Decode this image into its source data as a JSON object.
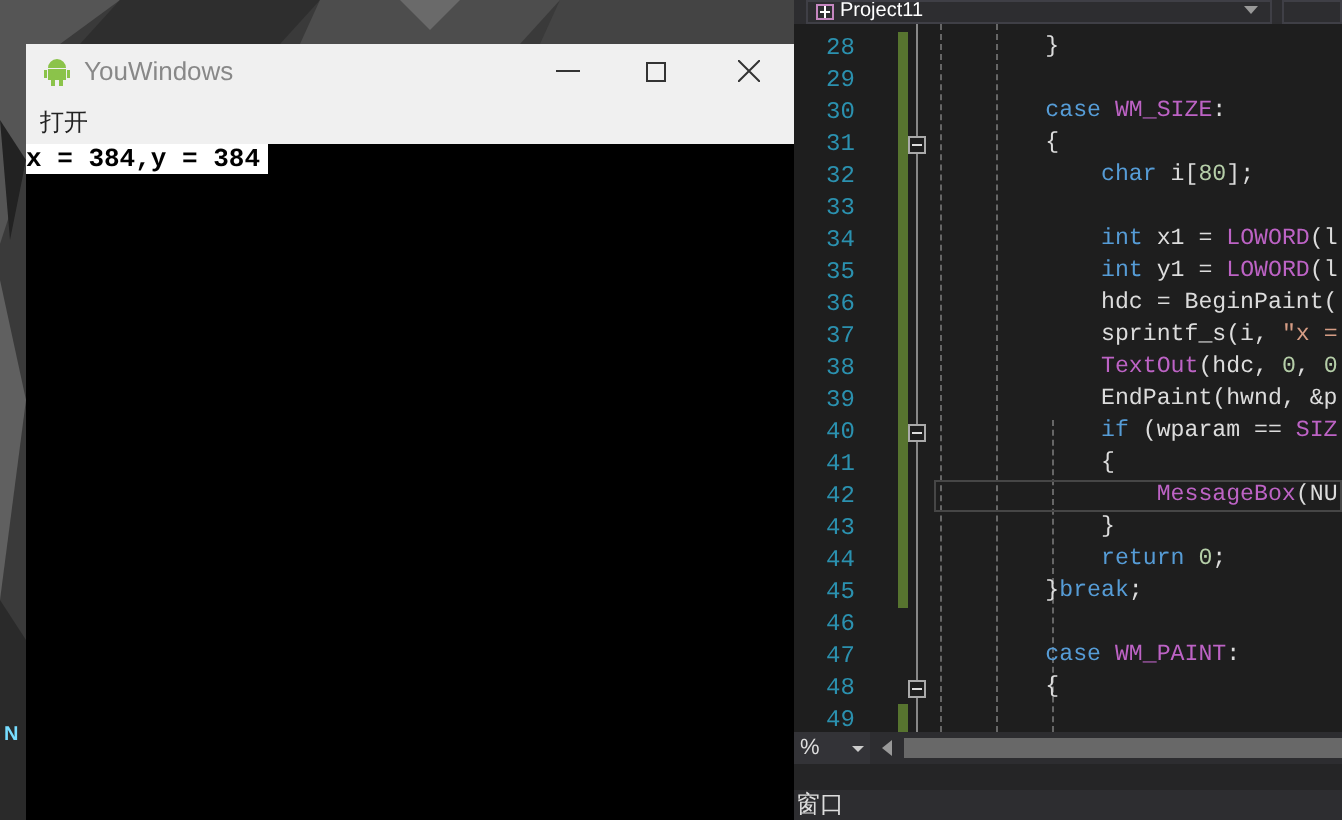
{
  "desktop_icon_label": "N",
  "app_window": {
    "title": "YouWindows",
    "menu": [
      "打开"
    ],
    "client_text": "x = 384,y = 384"
  },
  "editor": {
    "project": "Project11",
    "lines": [
      {
        "number": "28",
        "changed": true,
        "fold": false,
        "current": false,
        "tokens": [
          {
            "kind": "plain",
            "text": "        }"
          }
        ]
      },
      {
        "number": "29",
        "changed": true,
        "fold": false,
        "current": false
      },
      {
        "number": "30",
        "changed": true,
        "fold": false,
        "current": false,
        "tokens": [
          {
            "kind": "keyword",
            "text": "        case"
          },
          {
            "kind": "macro",
            "text": " WM_SIZE"
          },
          {
            "kind": "plain",
            "text": ":"
          }
        ]
      },
      {
        "number": "31",
        "changed": true,
        "fold": true,
        "current": false,
        "tokens": [
          {
            "kind": "plain",
            "text": "        {"
          }
        ]
      },
      {
        "number": "32",
        "changed": true,
        "fold": false,
        "current": false,
        "tokens": [
          {
            "kind": "keyword",
            "text": "            char"
          },
          {
            "kind": "plain",
            "text": " i["
          },
          {
            "kind": "number",
            "text": "80"
          },
          {
            "kind": "plain",
            "text": "];"
          }
        ]
      },
      {
        "number": "33",
        "changed": true,
        "fold": false,
        "current": false
      },
      {
        "number": "34",
        "changed": true,
        "fold": false,
        "current": false,
        "tokens": [
          {
            "kind": "keyword",
            "text": "            int"
          },
          {
            "kind": "plain",
            "text": " x1 ="
          },
          {
            "kind": "macro",
            "text": " LOWORD"
          },
          {
            "kind": "plain",
            "text": "(l"
          }
        ]
      },
      {
        "number": "35",
        "changed": true,
        "fold": false,
        "current": false,
        "tokens": [
          {
            "kind": "keyword",
            "text": "            int"
          },
          {
            "kind": "plain",
            "text": " y1 ="
          },
          {
            "kind": "macro",
            "text": " LOWORD"
          },
          {
            "kind": "plain",
            "text": "(l"
          }
        ]
      },
      {
        "number": "36",
        "changed": true,
        "fold": false,
        "current": false,
        "tokens": [
          {
            "kind": "plain",
            "text": "            hdc = BeginPaint("
          }
        ]
      },
      {
        "number": "37",
        "changed": true,
        "fold": false,
        "current": false,
        "tokens": [
          {
            "kind": "plain",
            "text": "            sprintf_s(i,"
          },
          {
            "kind": "string",
            "text": " \"x ="
          }
        ]
      },
      {
        "number": "38",
        "changed": true,
        "fold": false,
        "current": false,
        "tokens": [
          {
            "kind": "macro",
            "text": "            TextOut"
          },
          {
            "kind": "plain",
            "text": "(hdc,"
          },
          {
            "kind": "number",
            "text": " 0"
          },
          {
            "kind": "plain",
            "text": ","
          },
          {
            "kind": "number",
            "text": " 0"
          }
        ]
      },
      {
        "number": "39",
        "changed": true,
        "fold": false,
        "current": false,
        "tokens": [
          {
            "kind": "plain",
            "text": "            EndPaint(hwnd, &p"
          }
        ]
      },
      {
        "number": "40",
        "changed": true,
        "fold": true,
        "current": false,
        "tokens": [
          {
            "kind": "keyword",
            "text": "            if"
          },
          {
            "kind": "plain",
            "text": " (wparam =="
          },
          {
            "kind": "macro",
            "text": " SIZ"
          }
        ]
      },
      {
        "number": "41",
        "changed": true,
        "fold": false,
        "current": false,
        "tokens": [
          {
            "kind": "plain",
            "text": "            {"
          }
        ]
      },
      {
        "number": "42",
        "changed": true,
        "fold": false,
        "current": true,
        "tokens": [
          {
            "kind": "macro",
            "text": "                MessageBox"
          },
          {
            "kind": "plain",
            "text": "(NU"
          }
        ]
      },
      {
        "number": "43",
        "changed": true,
        "fold": false,
        "current": false,
        "tokens": [
          {
            "kind": "plain",
            "text": "            }"
          }
        ]
      },
      {
        "number": "44",
        "changed": true,
        "fold": false,
        "current": false,
        "tokens": [
          {
            "kind": "keyword",
            "text": "            return"
          },
          {
            "kind": "number",
            "text": " 0"
          },
          {
            "kind": "plain",
            "text": ";"
          }
        ]
      },
      {
        "number": "45",
        "changed": true,
        "fold": false,
        "current": false,
        "tokens": [
          {
            "kind": "plain",
            "text": "        }"
          },
          {
            "kind": "keyword",
            "text": "break"
          },
          {
            "kind": "plain",
            "text": ";"
          }
        ]
      },
      {
        "number": "46",
        "changed": false,
        "fold": false,
        "current": false
      },
      {
        "number": "47",
        "changed": false,
        "fold": false,
        "current": false,
        "tokens": [
          {
            "kind": "keyword",
            "text": "        case"
          },
          {
            "kind": "macro",
            "text": " WM_PAINT"
          },
          {
            "kind": "plain",
            "text": ":"
          }
        ]
      },
      {
        "number": "48",
        "changed": false,
        "fold": true,
        "current": false,
        "tokens": [
          {
            "kind": "plain",
            "text": "        {"
          }
        ]
      },
      {
        "number": "49",
        "changed": true,
        "fold": false,
        "current": false
      }
    ],
    "zoom": "%",
    "panel_tab": "窗口"
  }
}
